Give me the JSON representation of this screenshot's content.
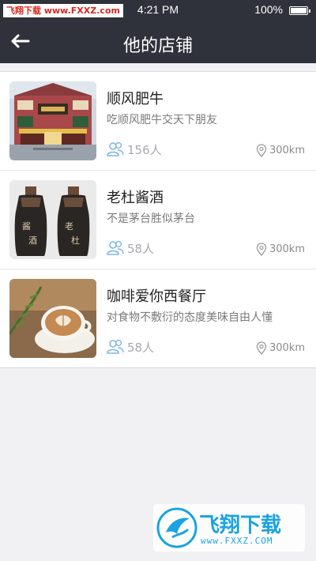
{
  "status_bar": {
    "watermark": "飞翔下载 www.FXXZ.com",
    "time": "4:21 PM",
    "battery": "100%"
  },
  "nav": {
    "title": "他的店铺",
    "back_icon": "back-arrow-icon"
  },
  "shops": [
    {
      "name": "顺风肥牛",
      "desc": "吃顺风肥牛交天下朋友",
      "fans": "156人",
      "distance": "300km",
      "image": "restaurant-storefront"
    },
    {
      "name": "老杜酱酒",
      "desc": "不是茅台胜似茅台",
      "fans": "58人",
      "distance": "300km",
      "image": "liquor-bottles"
    },
    {
      "name": "咖啡爱你西餐厅",
      "desc": "对食物不敷衍的态度美味自由人懂",
      "fans": "58人",
      "distance": "300km",
      "image": "latte-cup"
    }
  ],
  "logo": {
    "brand": "飞翔下载",
    "url": "www.FXXZ.COM"
  },
  "colors": {
    "header_bg": "#2f323a",
    "page_bg": "#f1f1f4",
    "icon_blue": "#7fb6e0",
    "brand_blue": "#1aa3e0"
  }
}
